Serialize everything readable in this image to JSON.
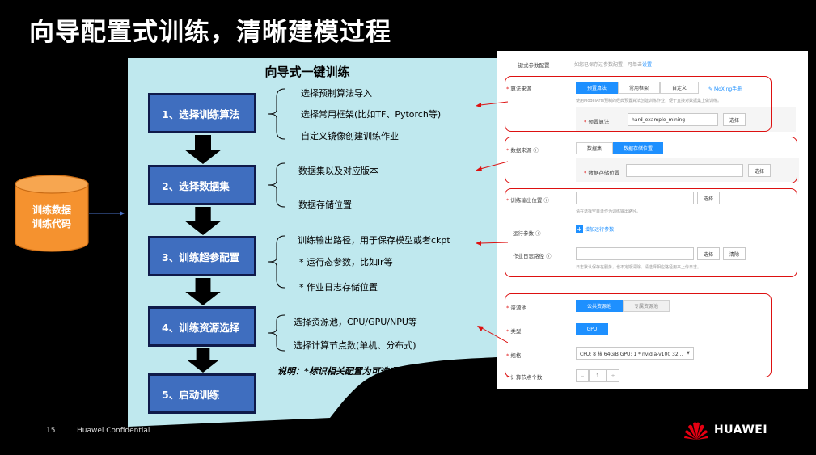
{
  "slide": {
    "title": "向导配置式训练，清晰建模过程",
    "page_number": "15",
    "confidential": "Huawei Confidential",
    "brand": "HUAWEI"
  },
  "source": {
    "line1": "训练数据",
    "line2": "训练代码"
  },
  "wizard": {
    "title": "向导式一键训练",
    "steps": [
      {
        "label": "1、选择训练算法"
      },
      {
        "label": "2、选择数据集"
      },
      {
        "label": "3、训练超参配置"
      },
      {
        "label": "4、训练资源选择"
      },
      {
        "label": "5、启动训练"
      }
    ],
    "options": {
      "s1": [
        "选择预制算法导入",
        "选择常用框架(比如TF、Pytorch等)",
        "自定义镜像创建训练作业"
      ],
      "s2": [
        "数据集以及对应版本",
        "数据存储位置"
      ],
      "s3": [
        "训练输出路径，用于保存模型或者ckpt",
        "* 运行态参数，比如lr等",
        "* 作业日志存储位置"
      ],
      "s4": [
        "选择资源池，CPU/GPU/NPU等",
        "选择计算节点数(单机、分布式)"
      ]
    },
    "note": "说明：*标识相关配置为可选项"
  },
  "form": {
    "one_click_label": "一键式参数配置",
    "one_click_hint": "如您已保存过参数配置，可单击",
    "one_click_link": "设置",
    "algo_source_label": "算法来源",
    "algo_tabs": [
      "预置算法",
      "常用框架",
      "自定义"
    ],
    "algo_link": "MoXing手册",
    "algo_hint": "使用ModelArts预制的经典预置算法创建训练作业，便于直接对数据集上做训练。",
    "preset_algo_label": "预置算法",
    "preset_algo_value": "hard_example_mining",
    "select_btn": "选择",
    "data_source_label": "数据来源",
    "data_tabs": [
      "数据集",
      "数据存储位置"
    ],
    "data_path_label": "数据存储位置",
    "output_label": "训练输出位置",
    "output_hint": "请在选择空目录作为训练输出路径。",
    "run_params_label": "运行参数",
    "run_params_add": "增加运行参数",
    "log_path_label": "作业日志路径",
    "log_hint": "日志默认保存在服务，也不定期清除，请选择相应路径用来上传日志。",
    "clear_btn": "清除",
    "pool_label": "资源池",
    "pool_tabs": [
      "公共资源池",
      "专属资源池"
    ],
    "type_label": "类型",
    "type_value": "GPU",
    "spec_label": "规格",
    "spec_value": "CPU: 8 核 64GiB GPU: 1 * nvidia-v100 32...",
    "nodes_label": "计算节点个数",
    "nodes_value": "1"
  },
  "colors": {
    "step_fill": "#3f6ebf",
    "panel_fill": "#bfe8ee",
    "cylinder_fill": "#f5922f",
    "highlight_red": "#d11111",
    "form_accent": "#1e90ff"
  }
}
